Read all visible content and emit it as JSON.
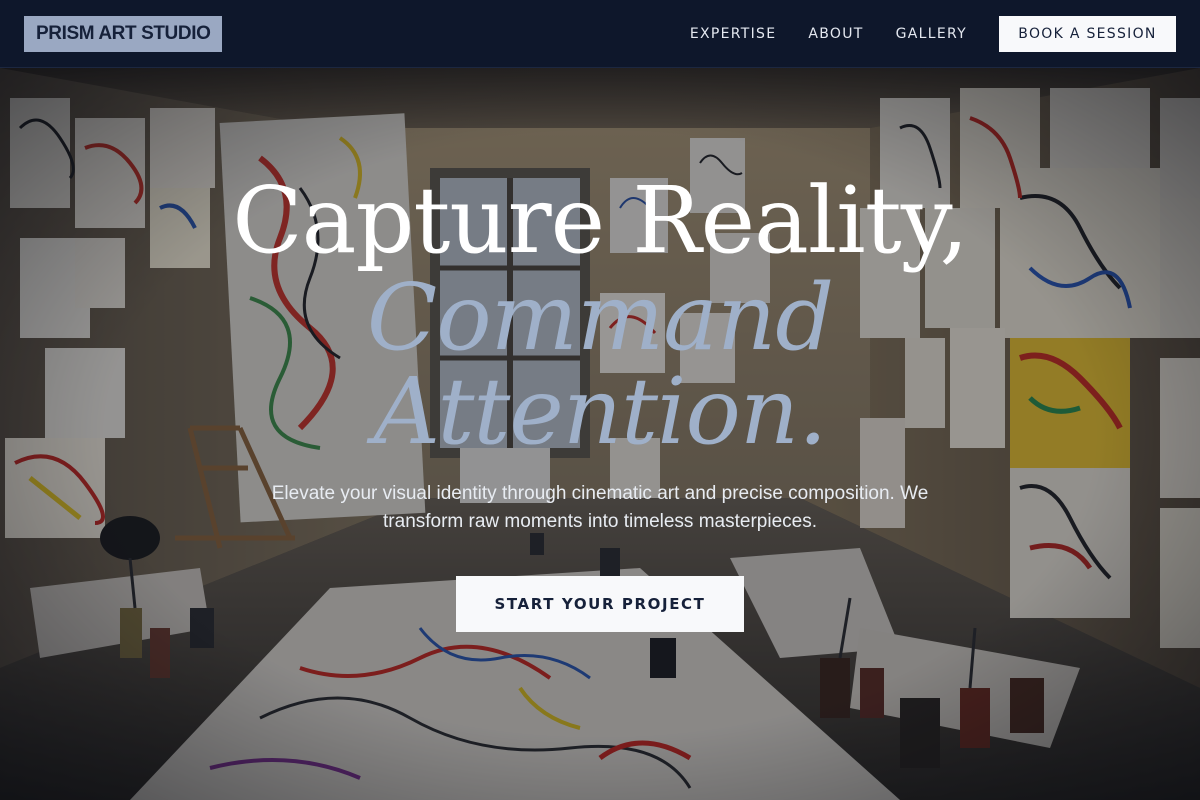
{
  "brand": {
    "name": "PRISM ART STUDIO"
  },
  "nav": {
    "links": [
      "EXPERTISE",
      "ABOUT",
      "GALLERY"
    ],
    "cta_label": "BOOK A SESSION"
  },
  "hero": {
    "headline_line1": "Capture Reality,",
    "headline_line2": "Command",
    "headline_line3": "Attention.",
    "subtitle": "Elevate your visual identity through cinematic art and precise composition. We transform raw moments into timeless masterpieces.",
    "cta_label": "START YOUR PROJECT"
  },
  "colors": {
    "nav_bg": "#0e172b",
    "logo_bg": "#9aa8c2",
    "accent_italic": "#9fb0c9",
    "button_bg": "#f8f9fb",
    "button_text": "#16213a"
  }
}
